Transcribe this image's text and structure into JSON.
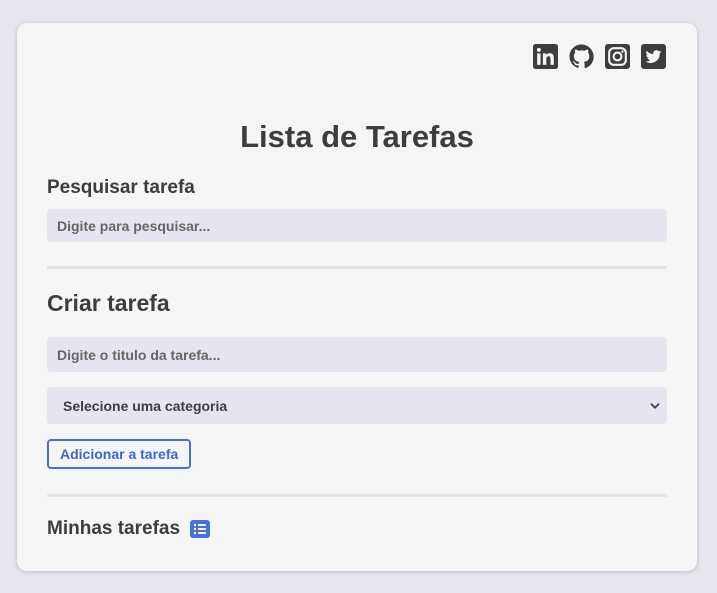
{
  "header": {
    "title": "Lista de Tarefas",
    "social_icons": [
      "linkedin-icon",
      "github-icon",
      "instagram-icon",
      "twitter-icon"
    ]
  },
  "search": {
    "label": "Pesquisar tarefa",
    "placeholder": "Digite para pesquisar..."
  },
  "create": {
    "label": "Criar tarefa",
    "title_placeholder": "Digite o titulo da tarefa...",
    "category_selected": "Selecione uma categoria",
    "add_button": "Adicionar a tarefa"
  },
  "tasks": {
    "label": "Minhas tarefas",
    "icon": "list-icon"
  },
  "colors": {
    "background": "#e6e6ef",
    "card": "#f5f5f5",
    "accent": "#4a6fd6",
    "text": "#3d3d3d",
    "field": "#e5e5ef"
  }
}
